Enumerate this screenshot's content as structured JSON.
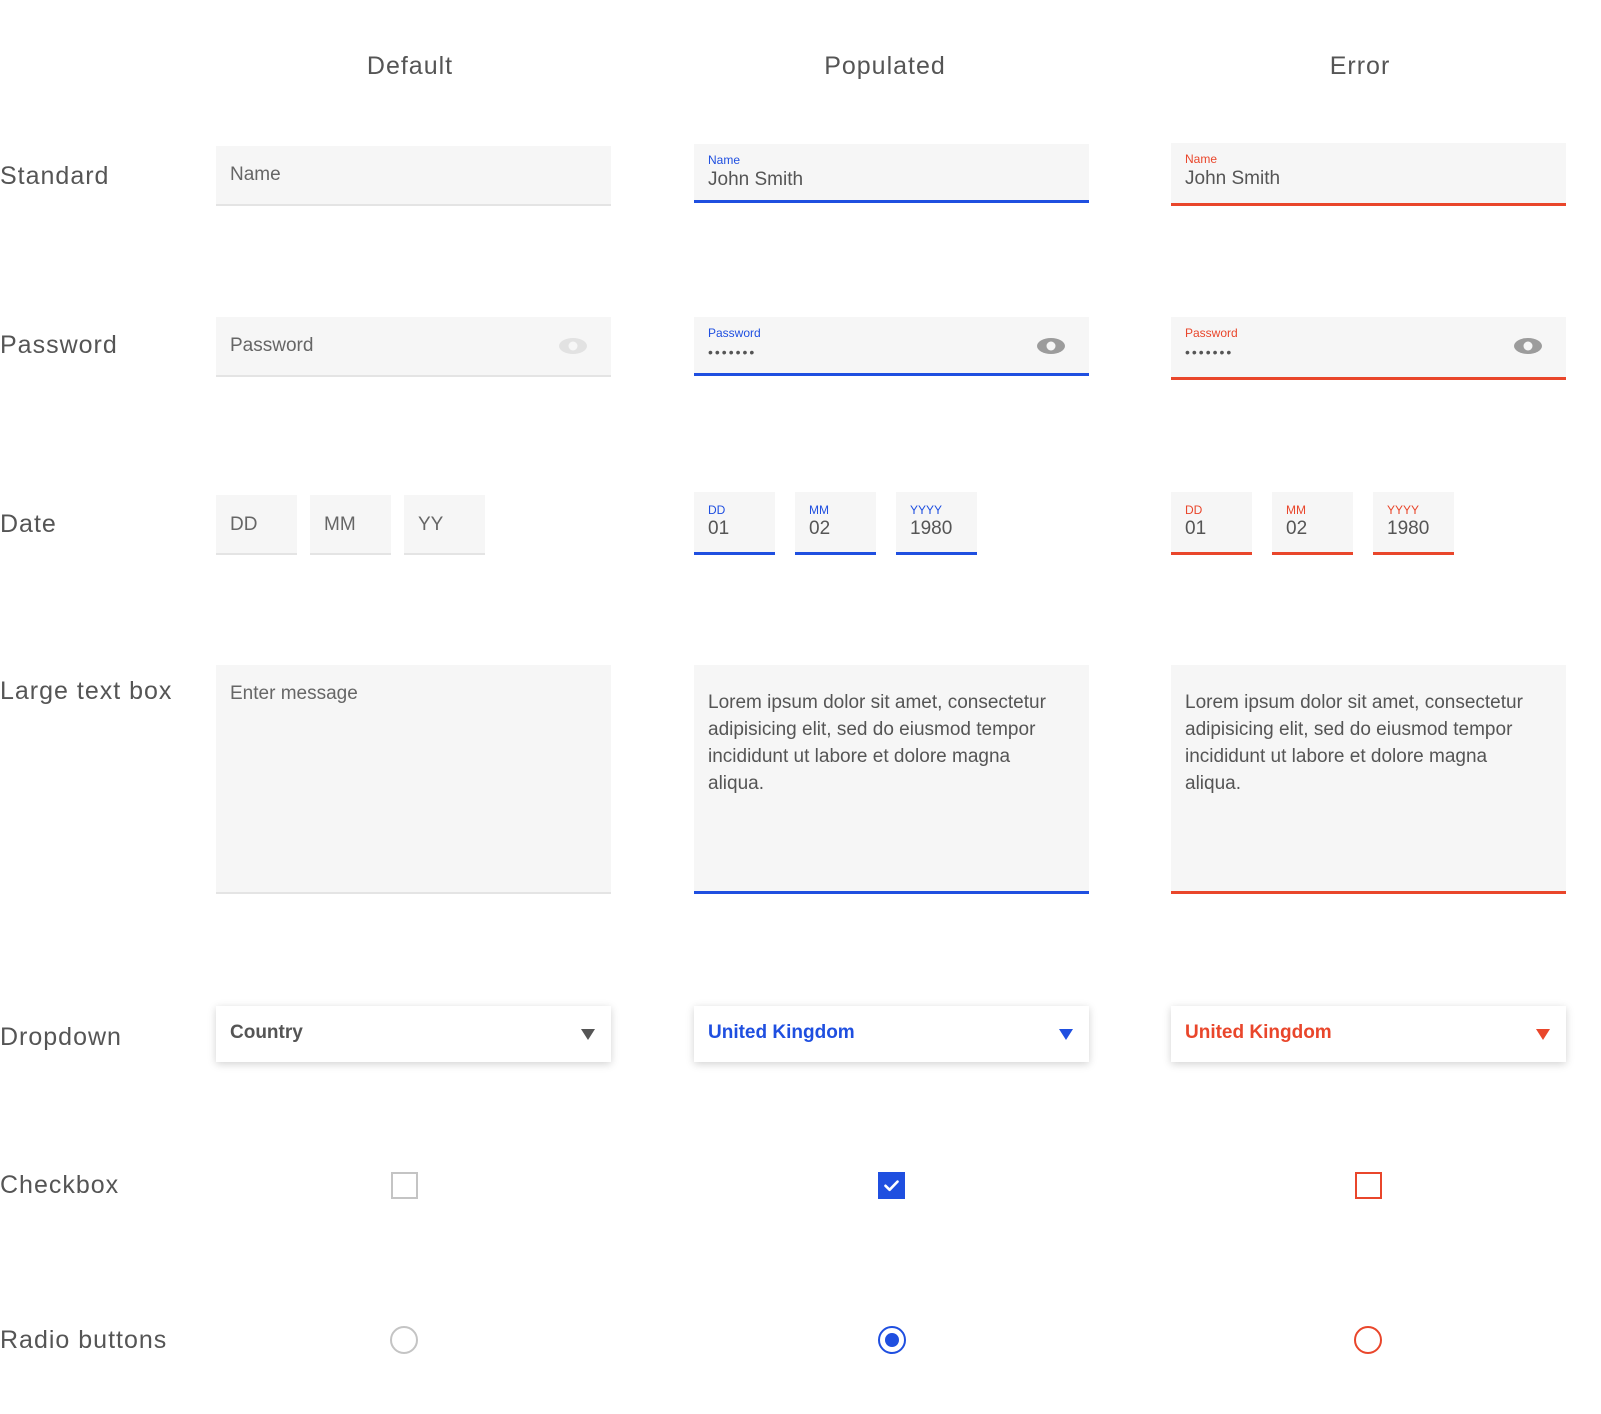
{
  "columns": {
    "default": "Default",
    "populated": "Populated",
    "error": "Error"
  },
  "rows": {
    "standard": "Standard",
    "password": "Password",
    "date": "Date",
    "large_text": "Large text box",
    "dropdown": "Dropdown",
    "checkbox": "Checkbox",
    "radio": "Radio buttons"
  },
  "colors": {
    "accent_blue": "#1f4fe0",
    "error_red": "#e9462b",
    "field_bg": "#f6f6f6",
    "text_gray": "#555555"
  },
  "standard": {
    "placeholder": "Name",
    "label": "Name",
    "value": "John Smith"
  },
  "password": {
    "placeholder": "Password",
    "label": "Password",
    "masked_value": "•••••••",
    "icon": "eye-icon"
  },
  "date": {
    "placeholders": [
      "DD",
      "MM",
      "YY"
    ],
    "labels": [
      "DD",
      "MM",
      "YYYY"
    ],
    "values": [
      "01",
      "02",
      "1980"
    ]
  },
  "large_text": {
    "placeholder": "Enter message",
    "value": "Lorem ipsum dolor sit amet, consectetur adipisicing elit, sed do eiusmod tempor incididunt ut labore et dolore magna aliqua."
  },
  "dropdown": {
    "placeholder": "Country",
    "value": "United Kingdom",
    "icon": "triangle-down-icon"
  },
  "checkbox": {
    "default_checked": false,
    "populated_checked": true,
    "error_checked": false,
    "icon": "checkmark-icon"
  },
  "radio": {
    "default_selected": false,
    "populated_selected": true,
    "error_selected": false
  }
}
